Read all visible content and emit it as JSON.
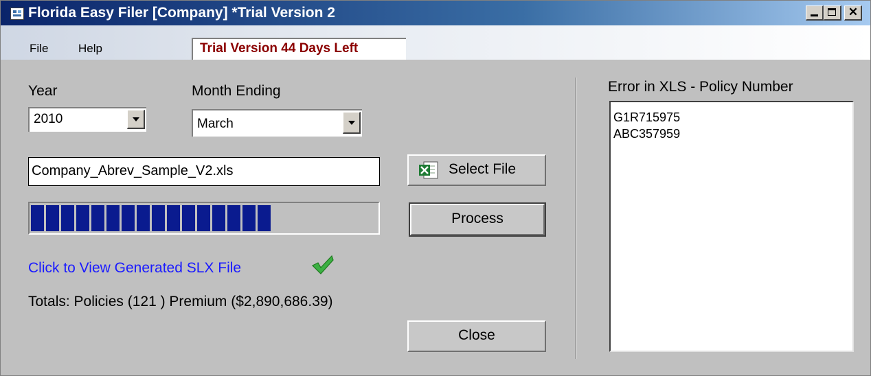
{
  "window": {
    "title": "Florida Easy Filer [Company]  *Trial Version 2",
    "trial_notice": "Trial Version 44 Days Left"
  },
  "menu": {
    "file": "File",
    "help": "Help"
  },
  "form": {
    "year_label": "Year",
    "year_value": "2010",
    "month_label": "Month Ending",
    "month_value": "March",
    "file_name": "Company_Abrev_Sample_V2.xls",
    "select_file_label": "Select File",
    "process_label": "Process",
    "progress": {
      "filled_segments": 16,
      "total_segments": 16
    },
    "view_link": "Click to View Generated SLX File",
    "totals": "Totals: Policies (121 ) Premium ($2,890,686.39)",
    "close_label": "Close"
  },
  "errors": {
    "header": "Error in XLS - Policy Number",
    "items": [
      "G1R715975",
      "ABC357959"
    ]
  },
  "colors": {
    "title_bar": "#0a246a",
    "trial_text": "#8b0000",
    "link": "#1a1aff",
    "progress_fill": "#0a1b8f",
    "check": "#3cb043"
  },
  "icons": {
    "app": "app-window-icon",
    "excel": "excel-icon",
    "check": "checkmark-icon"
  }
}
